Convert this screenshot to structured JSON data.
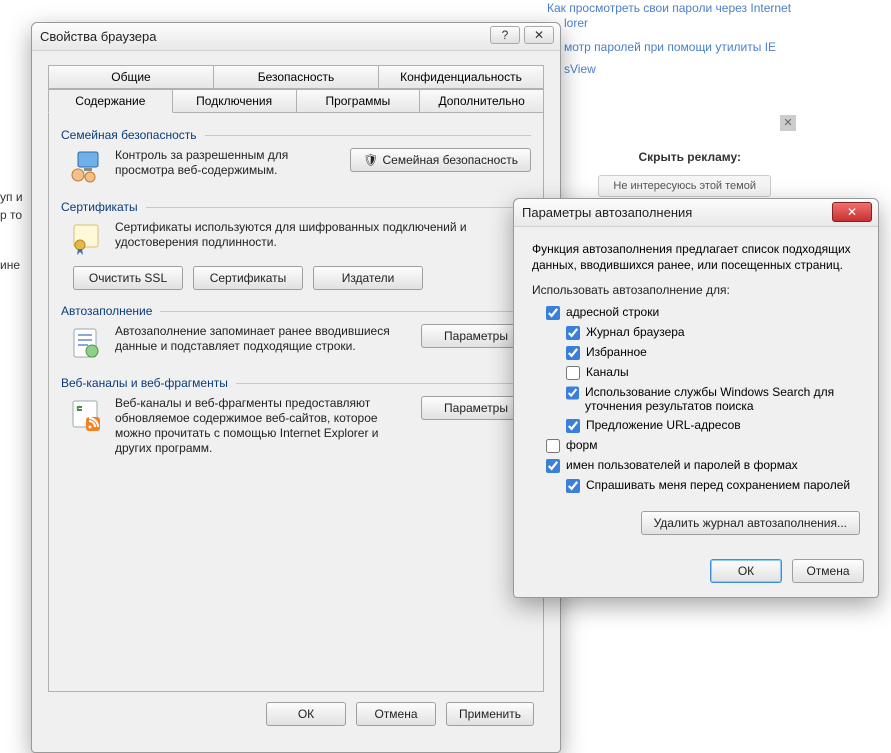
{
  "bg": {
    "link1": "Как просмотреть свои пароли через Internet",
    "link1b": "lorer",
    "link2": "мотр паролей при помощи утилиты IE",
    "link2b": "sView",
    "frag1": "уп и",
    "frag2": "р то",
    "frag3": "ине",
    "hide_label": "Скрыть рекламу:",
    "hide_btn": "Не интересуюсь этой темой"
  },
  "props": {
    "title": "Свойства браузера",
    "tabs_row1": [
      "Общие",
      "Безопасность",
      "Конфиденциальность"
    ],
    "tabs_row2": [
      "Содержание",
      "Подключения",
      "Программы",
      "Дополнительно"
    ],
    "family": {
      "header": "Семейная безопасность",
      "desc": "Контроль за разрешенным для просмотра веб-содержимым.",
      "btn": "Семейная безопасность"
    },
    "certs": {
      "header": "Сертификаты",
      "desc": "Сертификаты используются для шифрованных подключений и удостоверения подлинности.",
      "clear_ssl": "Очистить SSL",
      "certs_btn": "Сертификаты",
      "publishers": "Издатели"
    },
    "autofill": {
      "header": "Автозаполнение",
      "desc": "Автозаполнение запоминает ранее вводившиеся данные и подставляет подходящие строки.",
      "btn": "Параметры"
    },
    "feeds": {
      "header": "Веб-каналы и веб-фрагменты",
      "desc": "Веб-каналы и веб-фрагменты предоставляют обновляемое содержимое веб-сайтов, которое можно прочитать с помощью Internet Explorer и других программ.",
      "btn": "Параметры"
    },
    "footer": {
      "ok": "ОК",
      "cancel": "Отмена",
      "apply": "Применить"
    }
  },
  "af": {
    "title": "Параметры автозаполнения",
    "intro": "Функция автозаполнения предлагает список подходящих данных, вводившихся ранее, или посещенных страниц.",
    "use_for": "Использовать автозаполнение для:",
    "opts": {
      "addrbar": "адресной строки",
      "history": "Журнал браузера",
      "favorites": "Избранное",
      "channels": "Каналы",
      "winsearch": "Использование службы Windows Search для уточнения результатов поиска",
      "urlsuggest": "Предложение URL-адресов",
      "forms": "форм",
      "userpass": "имен пользователей и паролей в формах",
      "asksave": "Спрашивать меня перед сохранением паролей"
    },
    "delete_btn": "Удалить журнал автозаполнения...",
    "ok": "ОК",
    "cancel": "Отмена"
  }
}
